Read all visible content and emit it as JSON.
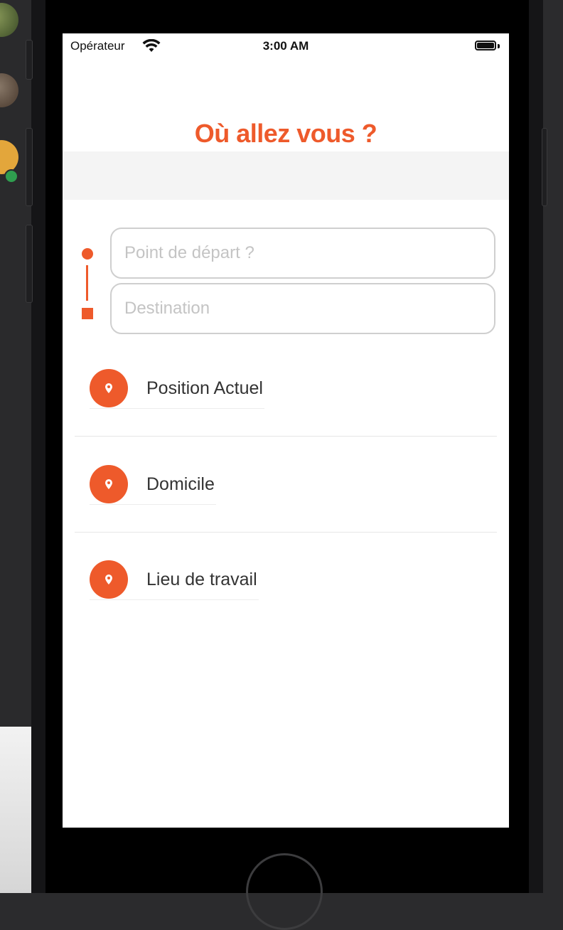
{
  "status_bar": {
    "carrier": "Opérateur",
    "time": "3:00 AM",
    "icons": [
      "wifi-icon",
      "battery-icon"
    ]
  },
  "screen": {
    "title": "Où allez vous ?",
    "departure_placeholder": "Point de départ ?",
    "destination_placeholder": "Destination",
    "departure_value": "",
    "destination_value": ""
  },
  "places": [
    {
      "label": "Position Actuel",
      "icon": "location-pin-icon"
    },
    {
      "label": "Domicile",
      "icon": "location-pin-icon"
    },
    {
      "label": "Lieu de travail",
      "icon": "location-pin-icon"
    }
  ],
  "colors": {
    "accent": "#ee5a2b",
    "field_border": "#cfcfcf",
    "band": "#f4f4f4"
  }
}
